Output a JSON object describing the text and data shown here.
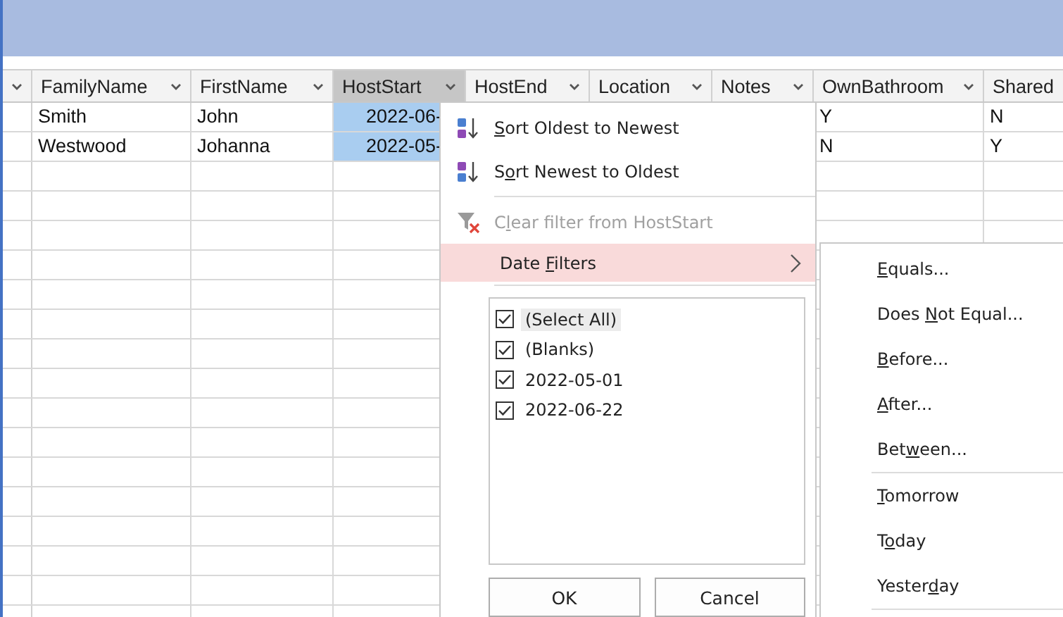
{
  "table": {
    "columns": [
      {
        "label": "FamilyName",
        "selected": false
      },
      {
        "label": "FirstName",
        "selected": false
      },
      {
        "label": "HostStart",
        "selected": true
      },
      {
        "label": "HostEnd",
        "selected": false
      },
      {
        "label": "Location",
        "selected": false
      },
      {
        "label": "Notes",
        "selected": false
      },
      {
        "label": "OwnBathroom",
        "selected": false
      },
      {
        "label": "Shared",
        "selected": false
      }
    ],
    "rows": [
      {
        "cells": [
          "Smith",
          "John",
          "2022-06-",
          null,
          null,
          null,
          "Y",
          "N"
        ]
      },
      {
        "cells": [
          "Westwood",
          "Johanna",
          "2022-05-",
          null,
          null,
          null,
          "N",
          "Y"
        ]
      }
    ]
  },
  "filter_menu": {
    "sort_items": [
      {
        "kind": "ascending",
        "key": "S",
        "post": "ort Oldest to Newest"
      },
      {
        "kind": "descending",
        "pre": "S",
        "key": "o",
        "post": "rt Newest to Oldest"
      }
    ],
    "clear_filter": {
      "pre": "C",
      "key": "l",
      "post": "ear filter from HostStart",
      "disabled": true
    },
    "date_filters": {
      "pre": "Date ",
      "key": "F",
      "post": "ilters",
      "selected": true
    },
    "values": [
      {
        "label": "(Select All)",
        "checked": true,
        "selected": true
      },
      {
        "label": "(Blanks)",
        "checked": true,
        "selected": false
      },
      {
        "label": "2022-05-01",
        "checked": true,
        "selected": false
      },
      {
        "label": "2022-06-22",
        "checked": true,
        "selected": false
      }
    ],
    "buttons": [
      {
        "label": "OK"
      },
      {
        "label": "Cancel"
      }
    ]
  },
  "date_filters_submenu": {
    "groups": [
      [
        {
          "key": "E",
          "post": "quals..."
        },
        {
          "pre": "Does ",
          "key": "N",
          "post": "ot Equal..."
        },
        {
          "key": "B",
          "post": "efore..."
        },
        {
          "key": "A",
          "post": "fter..."
        },
        {
          "pre": "Bet",
          "key": "w",
          "post": "een..."
        }
      ],
      [
        {
          "key": "T",
          "post": "omorrow"
        },
        {
          "pre": "T",
          "key": "o",
          "post": "day"
        },
        {
          "pre": "Yester",
          "key": "d",
          "post": "ay"
        }
      ]
    ]
  }
}
